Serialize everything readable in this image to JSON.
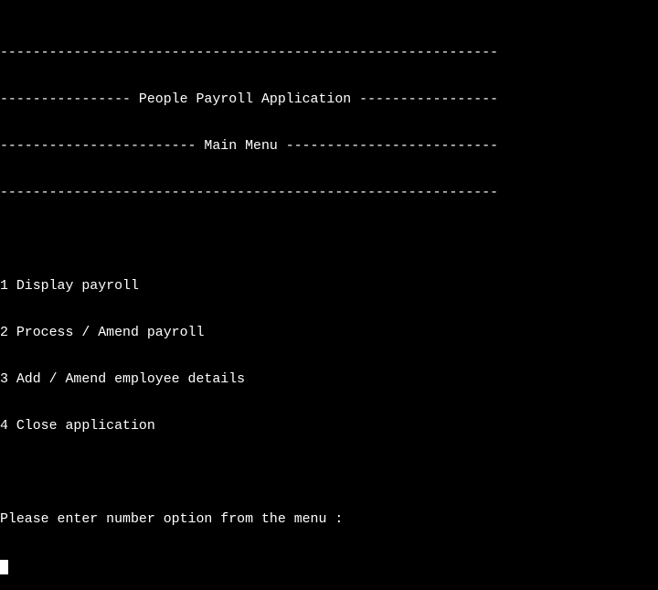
{
  "header": {
    "rule_top": "-------------------------------------------------------------",
    "title_line": "---------------- People Payroll Application -----------------",
    "subtitle_line": "------------------------ Main Menu --------------------------",
    "rule_bottom": "-------------------------------------------------------------"
  },
  "menu": {
    "items": [
      {
        "label": "1 Display payroll"
      },
      {
        "label": "2 Process / Amend payroll"
      },
      {
        "label": "3 Add / Amend employee details"
      },
      {
        "label": "4 Close application"
      }
    ]
  },
  "prompt": {
    "text": "Please enter number option from the menu :"
  },
  "input": {
    "value": ""
  },
  "colors": {
    "background": "#000000",
    "foreground": "#ffffff"
  }
}
